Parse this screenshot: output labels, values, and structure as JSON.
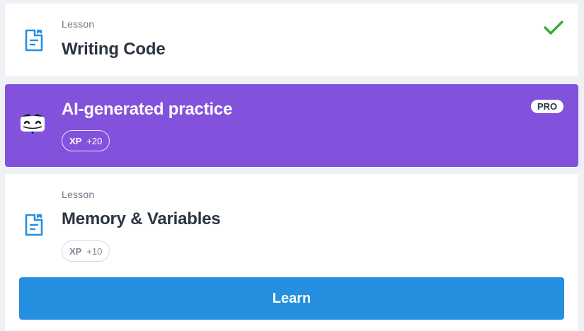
{
  "lessons": [
    {
      "eyebrow": "Lesson",
      "title": "Writing Code",
      "icon": "document-icon",
      "status_icon": "checkmark-icon",
      "accent": "#2590e0",
      "check_color": "#3aa83a"
    },
    {
      "title": "AI-generated practice",
      "icon": "robot-mascot-icon",
      "badge": "PRO",
      "xp_label": "XP",
      "xp_value": "+20",
      "background": "#8352dc"
    },
    {
      "eyebrow": "Lesson",
      "title": "Memory & Variables",
      "icon": "document-icon",
      "xp_label": "XP",
      "xp_value": "+10",
      "button_label": "Learn",
      "button_color": "#2590e0"
    }
  ]
}
